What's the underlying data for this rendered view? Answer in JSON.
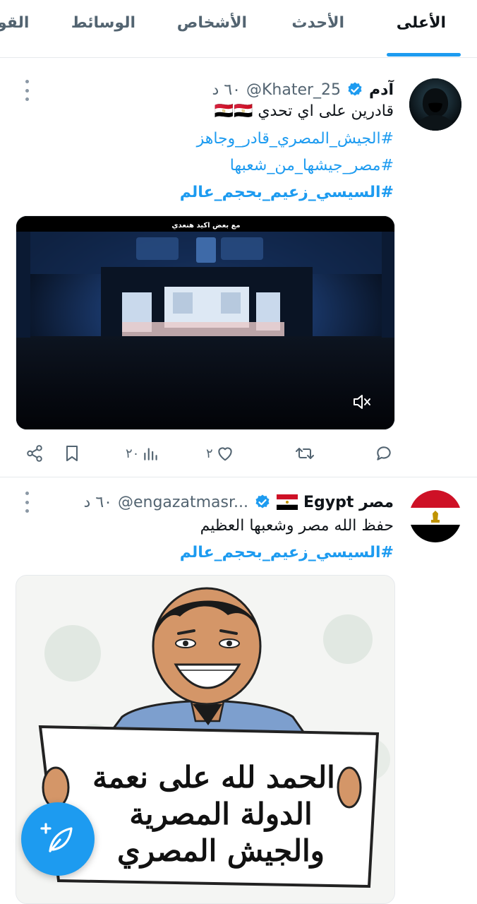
{
  "tabs": [
    {
      "label": "الأعلى",
      "active": true
    },
    {
      "label": "الأحدث",
      "active": false
    },
    {
      "label": "الأشخاص",
      "active": false
    },
    {
      "label": "الوسائط",
      "active": false
    },
    {
      "label": "القو",
      "active": false
    }
  ],
  "tweets": [
    {
      "name": "آدم",
      "handle": "@Khater_25",
      "time": "٦٠ د",
      "verified": true,
      "text": "قادرين على اي تحدي 🇪🇬🇪🇬",
      "hashtags": [
        "#الجيش_المصري_قادر_وجاهز",
        "#مصر_جيشها_من_شعبها",
        "#السيسي_زعيم_بحجم_عالم"
      ],
      "media": {
        "type": "video",
        "caption": "مع بعض اكيد هنعدي",
        "muted": true
      },
      "actions": {
        "replies": "",
        "retweets": "",
        "likes": "٢",
        "views": "٢٠"
      }
    },
    {
      "name": "مصر Egypt",
      "handle": "@engazatmasr...",
      "time": "٦٠ د",
      "verified": true,
      "text": "حفظ الله مصر وشعبها العظيم",
      "hashtags": [
        "#السيسي_زعيم_بحجم_عالم"
      ],
      "media": {
        "type": "image",
        "sign_lines": [
          "الحمد لله على نعمة",
          "الدولة المصرية",
          "والجيش المصري"
        ]
      }
    }
  ],
  "colors": {
    "accent": "#1d9bf0",
    "text": "#0f1419",
    "muted": "#536471",
    "border": "#e6e9ec"
  },
  "icons": [
    "share-icon",
    "bookmark-icon",
    "views-icon",
    "like-icon",
    "retweet-icon",
    "reply-icon",
    "more-icon",
    "verified-icon",
    "mute-icon",
    "compose-icon"
  ]
}
